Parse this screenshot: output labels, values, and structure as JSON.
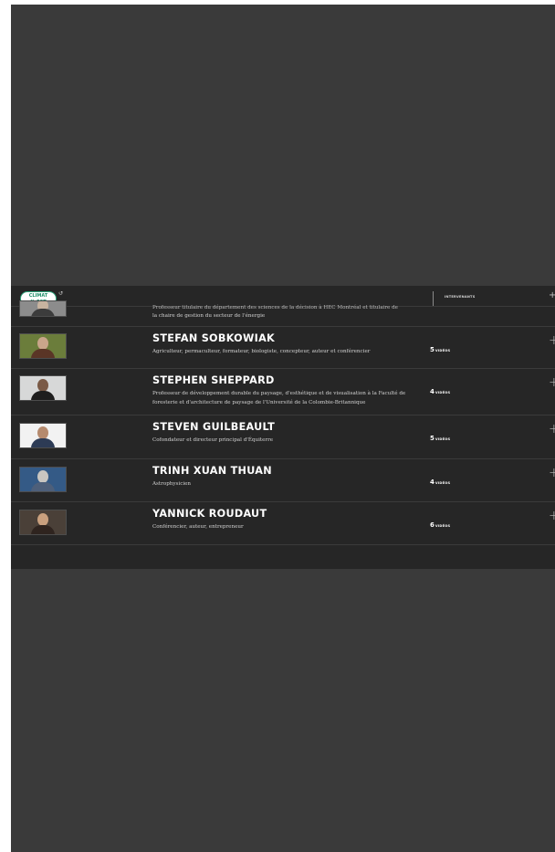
{
  "header": {
    "logo_text": "CLIMAT\nIL EST TEMPS",
    "tab_label": "INTERVENANTS"
  },
  "partial_row": {
    "desc_line1": "Professeur titulaire du département des sciences de la décision à HEC Montréal et titulaire de",
    "desc_line2": "la chaire de gestion du secteur de l'énergie"
  },
  "speakers": [
    {
      "name": "STEFAN SOBKOWIAK",
      "desc": "Agriculteur, permaculteur, formateur, biologiste, concepteur, auteur et conférencier",
      "count": "5",
      "unit": "VIDÉOS",
      "thumb_bg": "#6b7d3b",
      "head": "#c9a58a",
      "body": "#5a3526"
    },
    {
      "name": "STEPHEN SHEPPARD",
      "desc": "Professeur de développement durable du paysage, d'esthétique et de visualisation à la Faculté de foresterie et d'architecture de paysage de l'Université de la Colombie-Britannique",
      "count": "4",
      "unit": "VIDÉOS",
      "thumb_bg": "#d7d8d8",
      "head": "#7a5a46",
      "body": "#1e1e1e"
    },
    {
      "name": "STEVEN GUILBEAULT",
      "desc": "Cofondateur et directeur principal d'Équiterre",
      "count": "5",
      "unit": "VIDÉOS",
      "thumb_bg": "#f2f2f2",
      "head": "#b58a6e",
      "body": "#2d3b55"
    },
    {
      "name": "TRINH XUAN THUAN",
      "desc": "Astrophysicien",
      "count": "4",
      "unit": "VIDÉOS",
      "thumb_bg": "#345a86",
      "head": "#c9c6c1",
      "body": "#4d5f7a"
    },
    {
      "name": "YANNICK ROUDAUT",
      "desc": "Conférencier, auteur, entrepreneur",
      "count": "6",
      "unit": "VIDÉOS",
      "thumb_bg": "#4a4038",
      "head": "#c9a07e",
      "body": "#2f241f"
    }
  ],
  "plus_symbol": "+",
  "colors": {
    "page_bg": "#3a3a3a",
    "panel_bg": "#262626",
    "accent_logo": "#2aa37a"
  }
}
